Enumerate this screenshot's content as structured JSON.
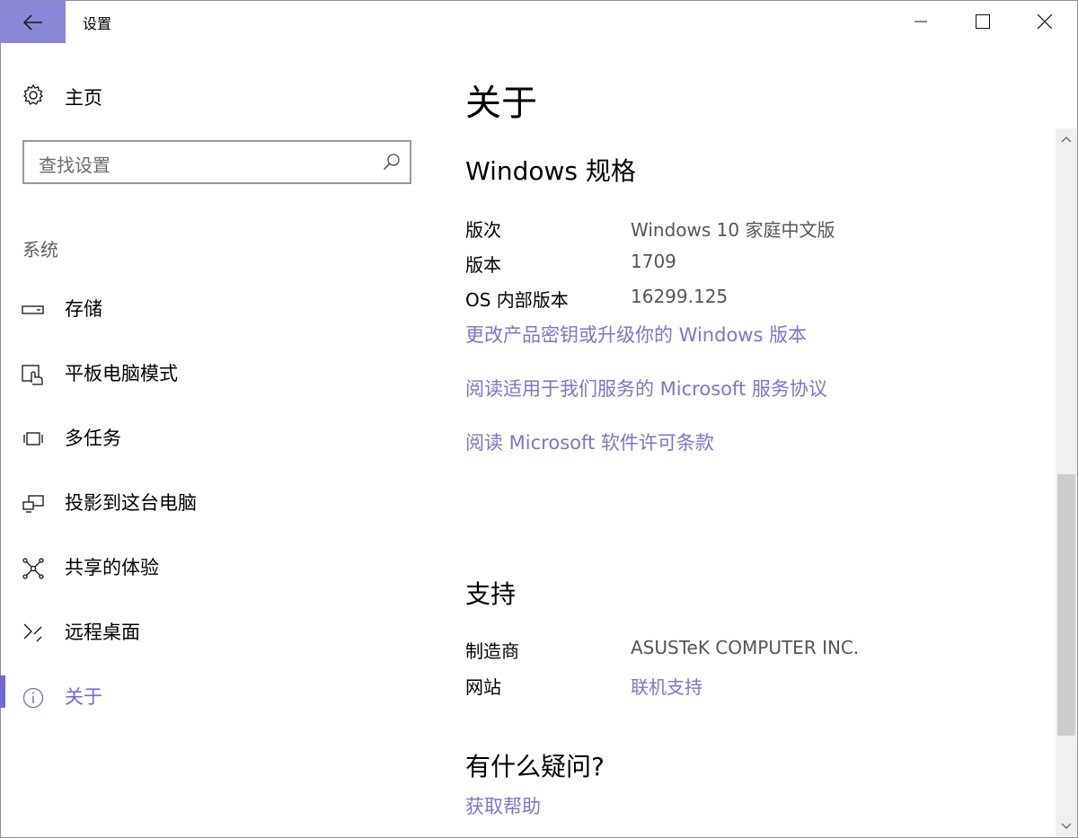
{
  "window": {
    "title": "设置",
    "controls": {
      "back": "back-arrow-icon",
      "minimize": "minimize-icon",
      "maximize": "maximize-icon",
      "close": "close-icon"
    }
  },
  "sidebar": {
    "home_label": "主页",
    "search_placeholder": "查找设置",
    "section_header": "系统",
    "items": [
      {
        "label": "存储",
        "icon": "storage-icon",
        "active": false
      },
      {
        "label": "平板电脑模式",
        "icon": "tablet-mode-icon",
        "active": false
      },
      {
        "label": "多任务",
        "icon": "multitasking-icon",
        "active": false
      },
      {
        "label": "投影到这台电脑",
        "icon": "project-icon",
        "active": false
      },
      {
        "label": "共享的体验",
        "icon": "shared-experiences-icon",
        "active": false
      },
      {
        "label": "远程桌面",
        "icon": "remote-desktop-icon",
        "active": false
      },
      {
        "label": "关于",
        "icon": "info-icon",
        "active": true
      }
    ]
  },
  "main": {
    "title": "关于",
    "specs_heading": "Windows 规格",
    "specs": [
      {
        "key": "版次",
        "value": "Windows 10 家庭中文版"
      },
      {
        "key": "版本",
        "value": "1709"
      },
      {
        "key": "OS 内部版本",
        "value": "16299.125"
      }
    ],
    "links": [
      "更改产品密钥或升级你的 Windows 版本",
      "阅读适用于我们服务的 Microsoft 服务协议",
      "阅读 Microsoft 软件许可条款"
    ],
    "support_heading": "支持",
    "support": [
      {
        "key": "制造商",
        "value": "ASUSTeK COMPUTER INC."
      },
      {
        "key": "网站",
        "value": "联机支持"
      }
    ],
    "question_heading": "有什么疑问?",
    "help_link": "获取帮助"
  },
  "colors": {
    "accent": "#6f6ad0",
    "back_button_bg": "#8a86d6",
    "link": "#7a76cc"
  }
}
